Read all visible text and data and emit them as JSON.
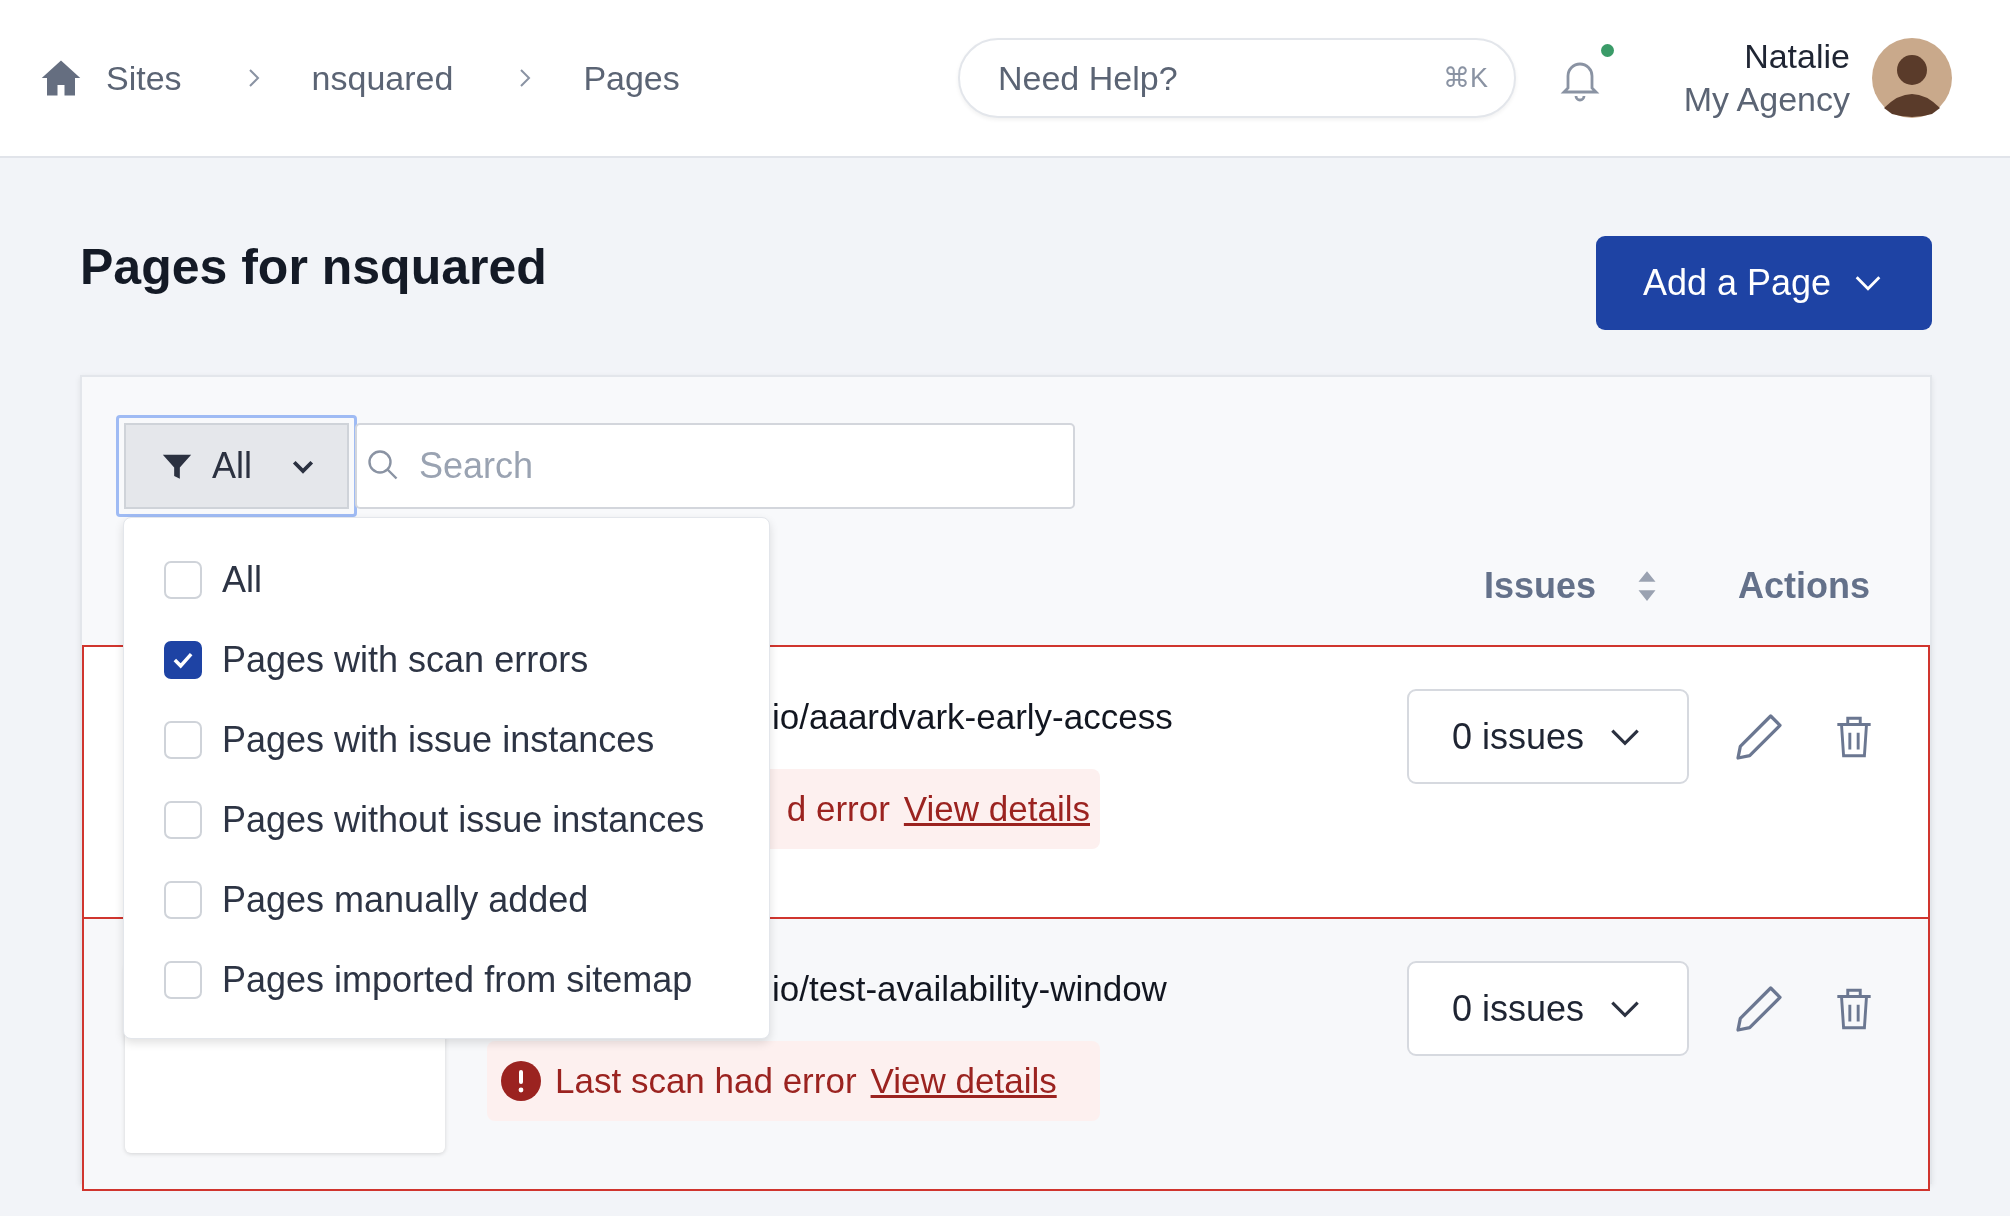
{
  "breadcrumbs": [
    {
      "label": "Sites"
    },
    {
      "label": "nsquared"
    },
    {
      "label": "Pages"
    }
  ],
  "help_search": {
    "placeholder": "Need Help?",
    "shortcut": "⌘K"
  },
  "notifications": {
    "unread": true
  },
  "user": {
    "name": "Natalie",
    "org": "My Agency"
  },
  "page_title": "Pages for nsquared",
  "add_button": {
    "label": "Add a Page"
  },
  "filter": {
    "label": "All",
    "expanded": true,
    "options": [
      {
        "label": "All",
        "checked": false
      },
      {
        "label": "Pages with scan errors",
        "checked": true
      },
      {
        "label": "Pages with issue instances",
        "checked": false
      },
      {
        "label": "Pages without issue instances",
        "checked": false
      },
      {
        "label": "Pages manually added",
        "checked": false
      },
      {
        "label": "Pages imported from sitemap",
        "checked": false
      }
    ]
  },
  "search": {
    "placeholder": "Search"
  },
  "table": {
    "columns": [
      {
        "label": "Issues",
        "sortable": true
      },
      {
        "label": "Actions",
        "sortable": false
      }
    ],
    "rows": [
      {
        "url": "io/aaardvark-early-access",
        "error": {
          "icon": false,
          "message": "d error",
          "link": "View details"
        },
        "issues": "0 issues"
      },
      {
        "url": "io/test-availability-window",
        "error": {
          "icon": true,
          "message": "Last scan had error",
          "link": "View details"
        },
        "issues": "0 issues"
      }
    ]
  }
}
